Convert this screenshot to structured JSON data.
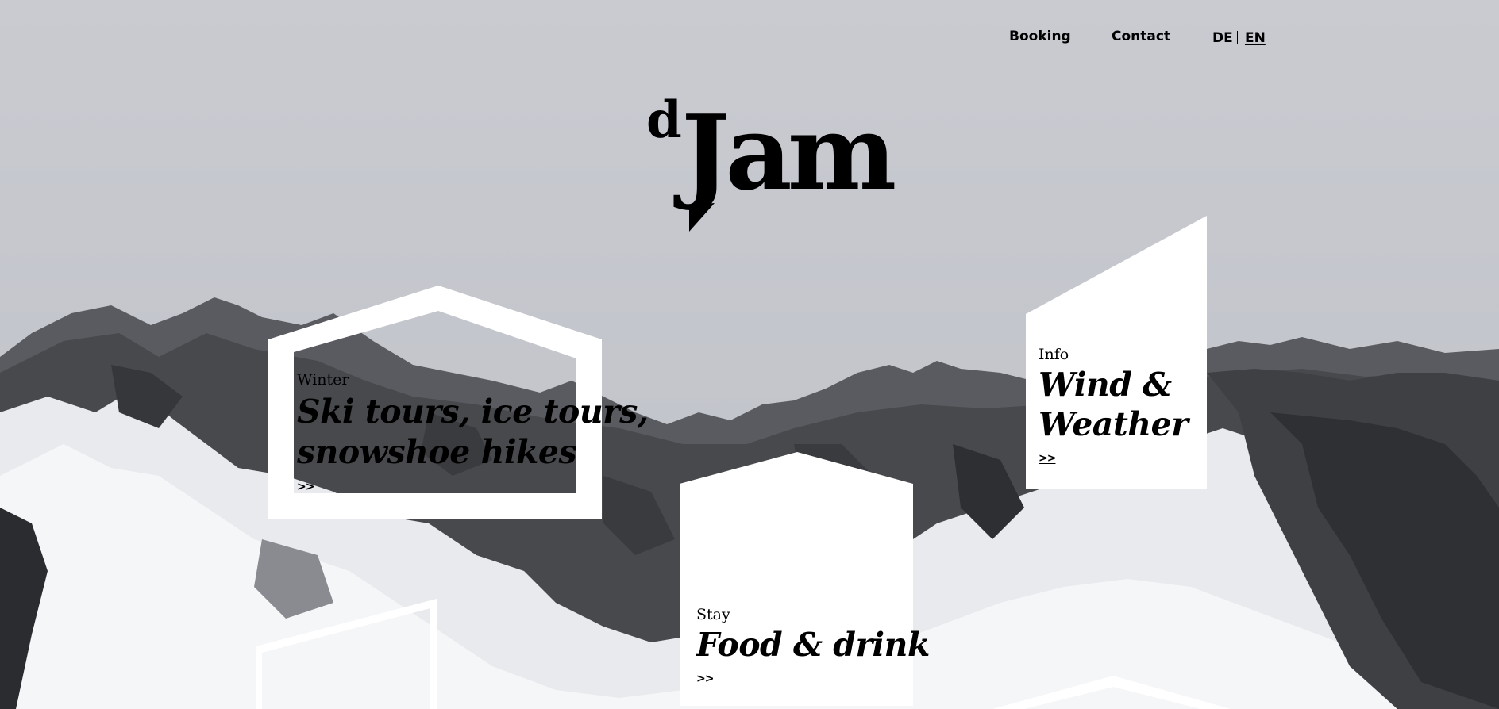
{
  "nav": {
    "booking": "Booking",
    "contact": "Contact",
    "lang_de": "DE",
    "lang_en": "EN"
  },
  "logo": {
    "small": "d",
    "main": "Jam"
  },
  "cards": {
    "winter": {
      "label": "Winter",
      "title_line1": "Ski tours, ice tours,",
      "title_line2": "snowshoe hikes",
      "arrow": ">>"
    },
    "info": {
      "label": "Info",
      "title_line1": "Wind &",
      "title_line2": "Weather",
      "arrow": ">>"
    },
    "stay": {
      "label": "Stay",
      "title": "Food & drink",
      "arrow": ">>"
    }
  },
  "colors": {
    "sky": "#c7c9cf",
    "rock": "#3e3f43",
    "snow": "#f1f2f4",
    "card": "#ffffff",
    "text": "#000000"
  }
}
